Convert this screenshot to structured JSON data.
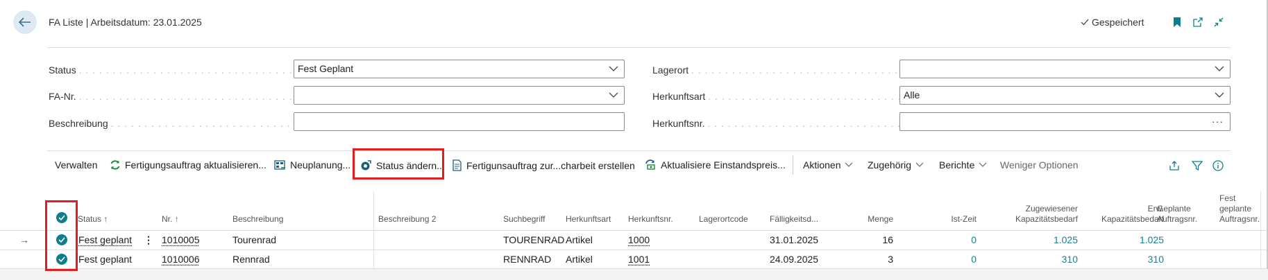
{
  "header": {
    "title": "FA Liste | Arbeitsdatum: 23.01.2025",
    "saved_label": "Gespeichert"
  },
  "filters": {
    "status": {
      "label": "Status",
      "value": "Fest Geplant"
    },
    "fa_nr": {
      "label": "FA-Nr.",
      "value": ""
    },
    "beschreibung": {
      "label": "Beschreibung",
      "value": ""
    },
    "lagerort": {
      "label": "Lagerort",
      "value": ""
    },
    "herkunftsart": {
      "label": "Herkunftsart",
      "value": "Alle"
    },
    "herkunftsnr": {
      "label": "Herkunftsnr.",
      "value": ""
    }
  },
  "actions": {
    "verwalten": "Verwalten",
    "fertigungsauftrag_aktualisieren": "Fertigungsauftrag aktualisieren...",
    "neuplanung": "Neuplanung...",
    "status_aendern": "Status ändern...",
    "fertigungsauftrag_zur": "Fertigunsauftrag zur...charbeit erstellen",
    "aktualisiere_einstandspreis": "Aktualisiere Einstandspreis...",
    "aktionen": "Aktionen",
    "zugehoerig": "Zugehörig",
    "berichte": "Berichte",
    "weniger_optionen": "Weniger Optionen"
  },
  "table": {
    "columns": {
      "status": "Status ↑",
      "nr": "Nr. ↑",
      "beschreibung": "Beschreibung",
      "beschreibung2": "Beschreibung 2",
      "suchbegriff": "Suchbegriff",
      "herkunftsart": "Herkunftsart",
      "herkunftsnr": "Herkunftsnr.",
      "lagerortcode": "Lagerortcode",
      "faelligkeit": "Fälligkeitsd...",
      "menge": "Menge",
      "istzeit": "Ist-Zeit",
      "zugewiesen_1": "Zugewiesener",
      "zugewiesen_2": "Kapazitätsbedarf",
      "erw_1": "Erw.",
      "erw_2": "Kapazitätsbedarf",
      "geplante_1": "Geplante",
      "geplante_2": "Auftragsnr.",
      "fest_1": "Fest",
      "fest_2": "geplante",
      "fest_3": "Auftragsnr."
    },
    "rows": [
      {
        "status": "Fest geplant",
        "nr": "1010005",
        "beschreibung": "Tourenrad",
        "beschreibung2": "",
        "suchbegriff": "TOURENRAD",
        "herkunftsart": "Artikel",
        "herkunftsnr": "1000",
        "lagerortcode": "",
        "faelligkeit": "31.01.2025",
        "menge": "16",
        "istzeit": "0",
        "zugewiesen": "1.025",
        "erw": "1.025"
      },
      {
        "status": "Fest geplant",
        "nr": "1010006",
        "beschreibung": "Rennrad",
        "beschreibung2": "",
        "suchbegriff": "RENNRAD",
        "herkunftsart": "Artikel",
        "herkunftsnr": "1001",
        "lagerortcode": "",
        "faelligkeit": "24.09.2025",
        "menge": "3",
        "istzeit": "0",
        "zugewiesen": "310",
        "erw": "310"
      }
    ]
  },
  "colors": {
    "accent": "#0d7f8c",
    "highlight": "#e02020",
    "back_button_bg": "#dde9f3"
  }
}
